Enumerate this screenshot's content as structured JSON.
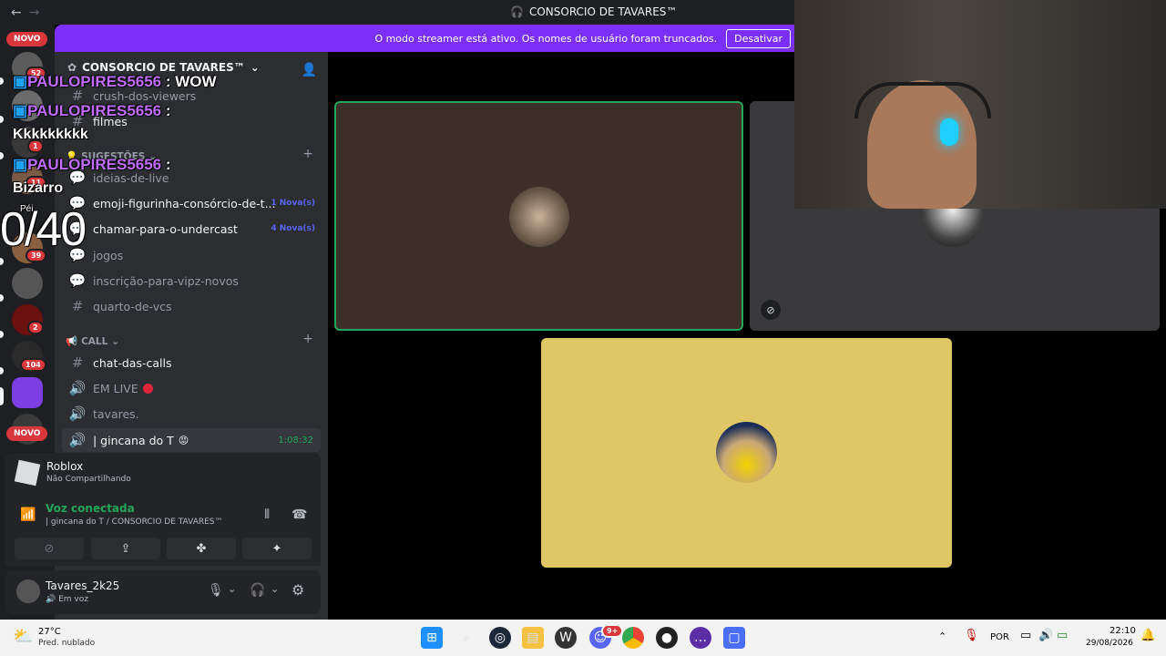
{
  "titlebar": {
    "back": "←",
    "forward": "→",
    "title": "CONSORCIO DE TAVARES™"
  },
  "banner": {
    "message": "O modo streamer está ativo. Os nomes de usuário foram truncados.",
    "button": "Desativar"
  },
  "rail": {
    "novo_top": "NOVO",
    "novo_bottom": "NOVO",
    "badges": [
      "52",
      "1",
      "11",
      "39",
      "2",
      "104"
    ]
  },
  "sidebar": {
    "server_name": "CONSORCIO DE TAVARES™",
    "channels_top": [
      {
        "label": "crush-dos-viewers"
      },
      {
        "label": "filmes"
      }
    ],
    "category_sugestoes": "SUGESTÕES",
    "channels_sug": [
      {
        "label": "ideias-de-live",
        "new": ""
      },
      {
        "label": "emoji-figurinha-consórcio-de-t...",
        "new": "1 Nova(s)"
      },
      {
        "label": "chamar-para-o-undercast",
        "new": "4 Nova(s)"
      },
      {
        "label": "jogos",
        "new": ""
      },
      {
        "label": "inscrição-para-vipz-novos",
        "new": ""
      },
      {
        "label": "quarto-de-vcs",
        "new": ""
      }
    ],
    "category_call": "CALL",
    "channels_call": [
      {
        "label": "chat-das-calls"
      },
      {
        "label": "EM LIVE"
      },
      {
        "label": "tavares."
      },
      {
        "label": "| gincana do T",
        "timer": "1:08:32"
      }
    ]
  },
  "activity": {
    "title": "Roblox",
    "subtitle": "Não Compartilhando"
  },
  "voice": {
    "status": "Voz conectada",
    "location": "| gincana do T  / CONSORCIO DE TAVARES™"
  },
  "user": {
    "name": "Tavares_2k25",
    "status": "Em voz"
  },
  "overlay": {
    "messages": [
      {
        "name": "PAULOPIRES5656",
        "text": " : WOW"
      },
      {
        "name": "PAULOPIRES5656",
        "text": " :"
      },
      {
        "name": "",
        "text": "Kkkkkkkkk"
      },
      {
        "name": "PAULOPIRES5656",
        "text": " :"
      },
      {
        "name": "",
        "text": "Bizarro"
      }
    ],
    "counter": "0/40",
    "pei": "Péi"
  },
  "taskbar": {
    "temp": "27°C",
    "weather": "Pred. nublado",
    "lang": "POR",
    "time": "22:10",
    "date": "29/08/2026",
    "discord_badge": "9+"
  },
  "colors": {
    "accent": "#5865f2",
    "banner": "#7b2ff7",
    "speaking": "#23a55a",
    "tile_yellow": "#e0c765",
    "tile_brown": "#3c2f28"
  }
}
